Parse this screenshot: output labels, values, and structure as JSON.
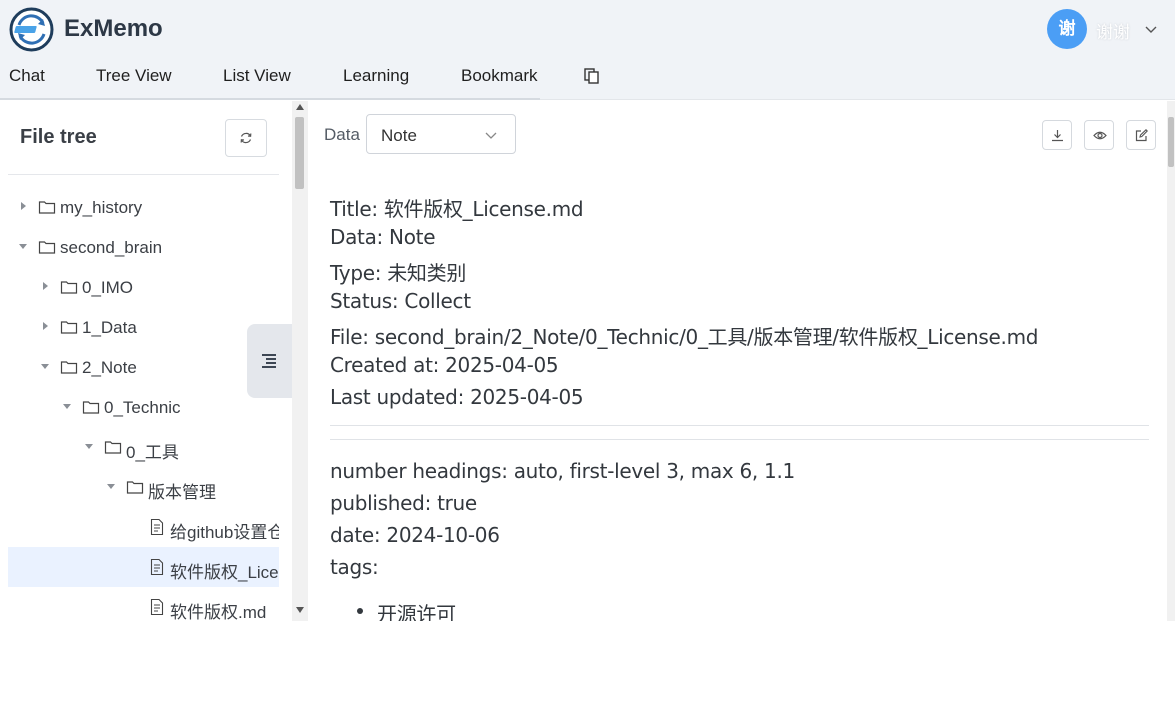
{
  "app": {
    "brand": "ExMemo"
  },
  "user": {
    "avatar_char": "谢",
    "name": "谢谢"
  },
  "nav": {
    "items": [
      "Chat",
      "Tree View",
      "List View",
      "Learning",
      "Bookmark"
    ],
    "extra_icon": "copy-icon"
  },
  "sidebar": {
    "title": "File tree",
    "refresh_icon": "refresh-icon",
    "tree": [
      {
        "label": "my_history",
        "type": "folder",
        "expanded": false,
        "depth": 0
      },
      {
        "label": "second_brain",
        "type": "folder",
        "expanded": true,
        "depth": 0
      },
      {
        "label": "0_IMO",
        "type": "folder",
        "expanded": false,
        "depth": 1
      },
      {
        "label": "1_Data",
        "type": "folder",
        "expanded": false,
        "depth": 1
      },
      {
        "label": "2_Note",
        "type": "folder",
        "expanded": true,
        "depth": 1
      },
      {
        "label": "0_Technic",
        "type": "folder",
        "expanded": true,
        "depth": 2
      },
      {
        "label": "0_工具",
        "type": "folder",
        "expanded": true,
        "depth": 3
      },
      {
        "label": "版本管理",
        "type": "folder",
        "expanded": true,
        "depth": 4
      },
      {
        "label": "给github设置仓",
        "type": "file",
        "depth": 5
      },
      {
        "label": "软件版权_License.md",
        "type": "file",
        "depth": 5,
        "selected": true
      },
      {
        "label": "软件版权.md",
        "type": "file",
        "depth": 5
      }
    ]
  },
  "content": {
    "data_label": "Data",
    "data_select": "Note",
    "toolbar": [
      "download-icon",
      "eye-icon",
      "edit-icon"
    ],
    "meta": [
      "Title: 软件版权_License.md",
      "Data: Note",
      "Type: 未知类别",
      "Status: Collect",
      "File: second_brain/2_Note/0_Technic/0_工具/版本管理/软件版权_License.md",
      "Created at: 2025-04-05",
      "Last updated: 2025-04-05"
    ],
    "frontmatter": [
      "number headings: auto, first-level 3, max 6, 1.1",
      "published: true",
      "date: 2024-10-06",
      "tags:"
    ],
    "tags": [
      "开源许可"
    ]
  },
  "colors": {
    "accent": "#4b9ef5",
    "selected_row": "#eaf2ff",
    "header_bg": "#f0f3f7"
  }
}
